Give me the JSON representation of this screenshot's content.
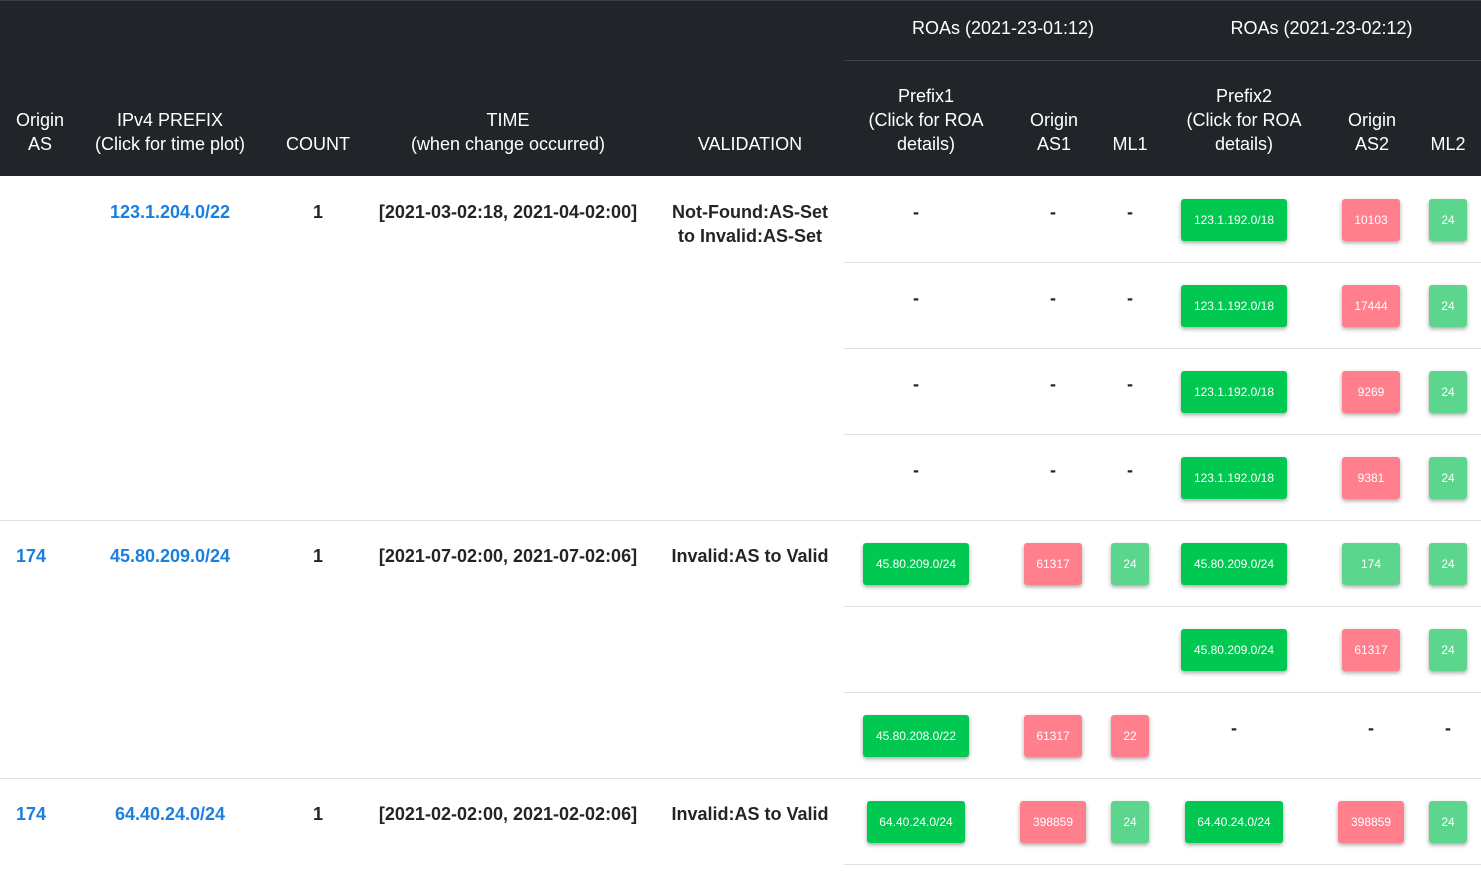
{
  "header": {
    "group1": "ROAs (2021-23-01:12)",
    "group2": "ROAs (2021-23-02:12)",
    "origin_as": "Origin\nAS",
    "prefix": "IPv4 PREFIX\n(Click for time plot)",
    "count": "COUNT",
    "time": "TIME\n(when change occurred)",
    "validation": "VALIDATION",
    "prefix1": "Prefix1\n(Click for ROA\ndetails)",
    "origin_as1": "Origin\nAS1",
    "ml1": "ML1",
    "prefix2": "Prefix2\n(Click for ROA\ndetails)",
    "origin_as2": "Origin\nAS2",
    "ml2": "ML2"
  },
  "colors": {
    "header_bg": "#212529",
    "link": "#1a7fe0",
    "badge_green": "#00c851",
    "badge_red": "#ff7f8c",
    "badge_light_green": "#5bd68c"
  },
  "groups": [
    {
      "origin_as": "",
      "prefix": "123.1.204.0/22",
      "count": "1",
      "time": "[2021-03-02:18, 2021-04-02:00]",
      "validation": "Not-Found:AS-Set\nto Invalid:AS-Set",
      "rows": [
        {
          "p1": null,
          "as1": null,
          "ml1": null,
          "p2": "123.1.192.0/18",
          "as2": "10103",
          "as2_color": "red",
          "ml2": "24",
          "ml2_color": "lgreen",
          "as1_color": "",
          "ml1_color": ""
        },
        {
          "p1": null,
          "as1": null,
          "ml1": null,
          "p2": "123.1.192.0/18",
          "as2": "17444",
          "as2_color": "red",
          "ml2": "24",
          "ml2_color": "lgreen",
          "as1_color": "",
          "ml1_color": ""
        },
        {
          "p1": null,
          "as1": null,
          "ml1": null,
          "p2": "123.1.192.0/18",
          "as2": "9269",
          "as2_color": "red",
          "ml2": "24",
          "ml2_color": "lgreen",
          "as1_color": "",
          "ml1_color": ""
        },
        {
          "p1": null,
          "as1": null,
          "ml1": null,
          "p2": "123.1.192.0/18",
          "as2": "9381",
          "as2_color": "red",
          "ml2": "24",
          "ml2_color": "lgreen",
          "as1_color": "",
          "ml1_color": ""
        }
      ]
    },
    {
      "origin_as": "174",
      "prefix": "45.80.209.0/24",
      "count": "1",
      "time": "[2021-07-02:00, 2021-07-02:06]",
      "validation": "Invalid:AS to Valid",
      "rows": [
        {
          "p1": "45.80.209.0/24",
          "as1": "61317",
          "as1_color": "red",
          "ml1": "24",
          "ml1_color": "lgreen",
          "p2": "45.80.209.0/24",
          "as2": "174",
          "as2_color": "lgreen",
          "ml2": "24",
          "ml2_color": "lgreen"
        },
        {
          "p1": "",
          "as1": "",
          "as1_color": "",
          "ml1": "",
          "ml1_color": "",
          "p2": "45.80.209.0/24",
          "as2": "61317",
          "as2_color": "red",
          "ml2": "24",
          "ml2_color": "lgreen"
        },
        {
          "p1": "45.80.208.0/22",
          "as1": "61317",
          "as1_color": "red",
          "ml1": "22",
          "ml1_color": "red",
          "p2": null,
          "as2": null,
          "as2_color": "",
          "ml2": null,
          "ml2_color": ""
        }
      ]
    },
    {
      "origin_as": "174",
      "prefix": "64.40.24.0/24",
      "count": "1",
      "time": "[2021-02-02:00, 2021-02-02:06]",
      "validation": "Invalid:AS to Valid",
      "rows": [
        {
          "p1": "64.40.24.0/24",
          "as1": "398859",
          "as1_color": "red",
          "ml1": "24",
          "ml1_color": "lgreen",
          "p2": "64.40.24.0/24",
          "as2": "398859",
          "as2_color": "red",
          "ml2": "24",
          "ml2_color": "lgreen"
        }
      ]
    }
  ]
}
